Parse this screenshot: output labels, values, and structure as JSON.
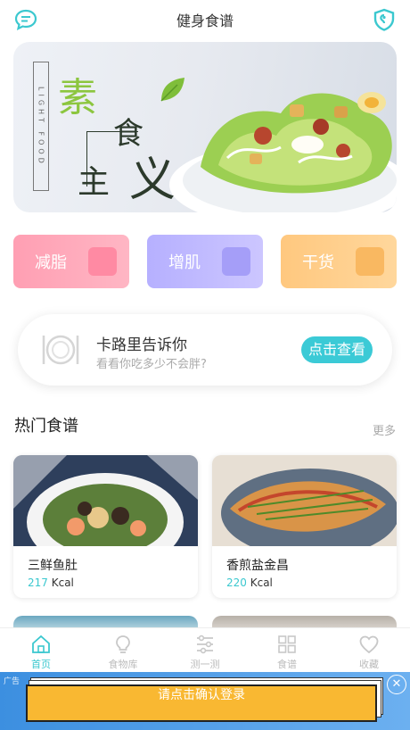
{
  "header": {
    "title": "健身食谱",
    "left_icon": "chat-icon",
    "right_icon": "shield-icon"
  },
  "banner": {
    "vertical_text": "LIGHT FOOD",
    "char1": "素",
    "char2": "食",
    "char3": "主",
    "char4": "义"
  },
  "categories": [
    {
      "label": "减脂",
      "icon": "scale-icon",
      "color": "#ff9fb3"
    },
    {
      "label": "增肌",
      "icon": "dumbbell-icon",
      "color": "#b6b0ff"
    },
    {
      "label": "干货",
      "icon": "document-icon",
      "color": "#ffc87f"
    }
  ],
  "calorie_card": {
    "title": "卡路里告诉你",
    "subtitle": "看看你吃多少不会胖?",
    "button": "点击查看",
    "icon": "plate-icon"
  },
  "hot_recipes": {
    "title": "热门食谱",
    "more": "更多",
    "items": [
      {
        "name": "三鲜鱼肚",
        "kcal": "217",
        "unit": "Kcal"
      },
      {
        "name": "香煎盐金昌",
        "kcal": "220",
        "unit": "Kcal"
      }
    ]
  },
  "tabbar": {
    "items": [
      {
        "label": "首页",
        "icon": "home-icon",
        "active": true
      },
      {
        "label": "食物库",
        "icon": "lightbulb-icon",
        "active": false
      },
      {
        "label": "测一测",
        "icon": "sliders-icon",
        "active": false
      },
      {
        "label": "食谱",
        "icon": "grid-icon",
        "active": false
      },
      {
        "label": "收藏",
        "icon": "heart-icon",
        "active": false
      }
    ],
    "active_color": "#3bc8cf"
  },
  "ad": {
    "tag": "广告",
    "login_text": "请点击确认登录",
    "close": "✕"
  }
}
